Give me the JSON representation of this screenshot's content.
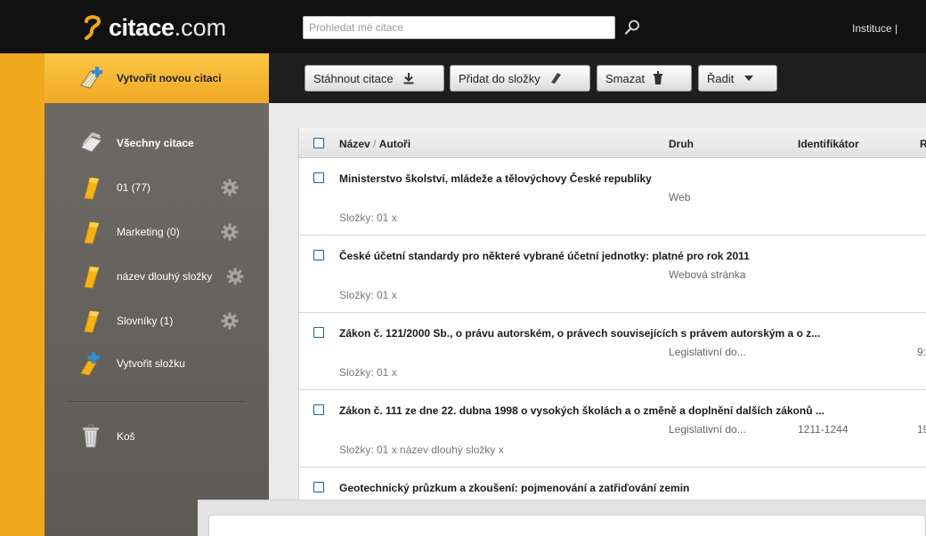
{
  "brand": {
    "bold": "citace",
    "thin": ".com",
    "accent": "#f3a716"
  },
  "search": {
    "placeholder": "Prohledat mé citace",
    "value": "",
    "icon": "search-icon"
  },
  "topnav": {
    "text": "Instituce  |"
  },
  "sidebar": {
    "create_citation": "Vytvořit novou citaci",
    "all_citations": "Všechny citace",
    "folders": [
      {
        "label": "01 (77)"
      },
      {
        "label": "Marketing (0)"
      },
      {
        "label": "název dlouhý složky"
      },
      {
        "label": "Slovníky (1)"
      }
    ],
    "create_folder": "Vytvořit složku",
    "trash": "Koš"
  },
  "toolbar": {
    "download": "Stáhnout citace",
    "add_to_folder": "Přidat do složky",
    "delete": "Smazat",
    "sort": "Řadit"
  },
  "table": {
    "headers": {
      "name": "Název",
      "authors": "Autoři",
      "type": "Druh",
      "identifier": "Identifikátor",
      "r": "R"
    },
    "rows": [
      {
        "title": "Ministerstvo školství, mládeže a tělovýchovy České republiky",
        "type": "Web",
        "identifier": "",
        "r": "",
        "folders": "Složky:  01 x"
      },
      {
        "title": "České účetní standardy pro některé vybrané účetní jednotky: platné pro rok 2011",
        "type": "Webová stránka",
        "identifier": "",
        "r": "",
        "folders": "Složky:  01 x"
      },
      {
        "title": "Zákon č. 121/2000 Sb., o právu autorském, o právech souvisejících s právem autorským a o z...",
        "type": "Legislativní do...",
        "identifier": "",
        "r": "9:",
        "folders": "Složky:  01 x"
      },
      {
        "title": "Zákon č. 111 ze dne 22. dubna 1998 o vysokých školách a o změně a doplnění dalších zákonů ...",
        "type": "Legislativní do...",
        "identifier": "1211-1244",
        "r": "19",
        "folders": "Složky:  01 x   název dlouhý složky x"
      },
      {
        "title": "Geotechnický průzkum a zkoušení: pojmenování a zatřiďování zemin",
        "type": "",
        "identifier": "",
        "r": "",
        "folders": ""
      }
    ]
  }
}
